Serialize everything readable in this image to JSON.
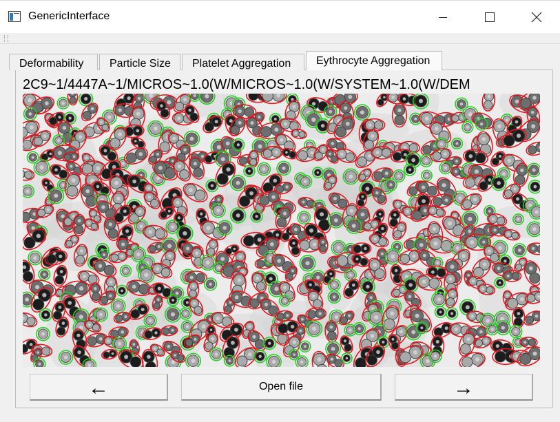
{
  "window": {
    "title": "GenericInterface"
  },
  "tabs": [
    {
      "label": "Deformability",
      "active": false
    },
    {
      "label": "Particle Size",
      "active": false
    },
    {
      "label": "Platelet Aggregation",
      "active": false
    },
    {
      "label": "Eythrocyte Aggregation",
      "active": true
    }
  ],
  "viewer": {
    "path_text": "2C9~1/4447A~1/MICROS~1.0(W/MICROS~1.0(W/SYSTEM~1.0(W/DEM",
    "image_icon": "microscopy-blood-cells-image",
    "outline_colors": {
      "aggregated": "#e8161c",
      "single": "#22d11c"
    }
  },
  "buttons": {
    "prev_label": "←",
    "open_label": "Open file",
    "next_label": "→"
  }
}
